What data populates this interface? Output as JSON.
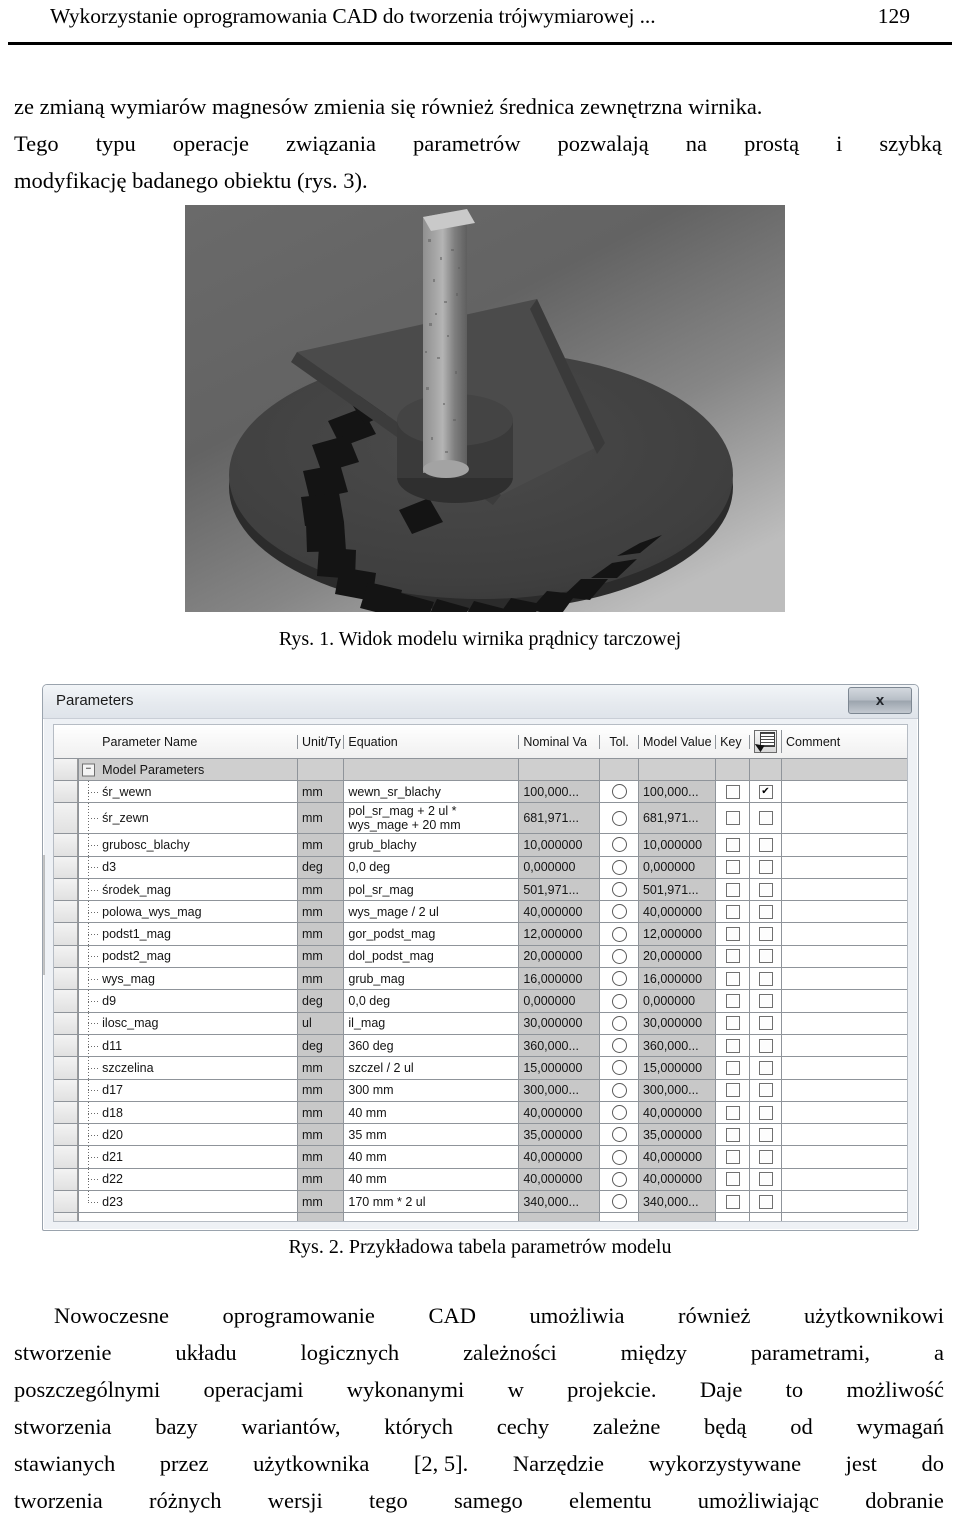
{
  "header": {
    "running_title": "Wykorzystanie oprogramowania CAD do tworzenia trójwymiarowej ...",
    "page_number": "129"
  },
  "paragraph_top": {
    "line1": "ze zmianą wymiarów magnesów zmienia się również średnica zewnętrzna wirnika.",
    "line2_a": "Tego",
    "line2_b": "typu",
    "line2_c": "operacje",
    "line2_d": "związania",
    "line2_e": "parametrów",
    "line2_f": "pozwalają",
    "line2_g": "na",
    "line2_h": "prostą",
    "line2_i": "i",
    "line2_j": "szybką",
    "line3": "modyfikację badanego obiektu (rys. 3)."
  },
  "figure1": {
    "caption": "Rys. 1. Widok modelu wirnika prądnicy tarczowej",
    "alt": "Widok modelu wirnika prądnicy tarczowej — render 3D tarczy z magnesami i wałem"
  },
  "figure2": {
    "caption": "Rys. 2. Przykładowa tabela parametrów modelu"
  },
  "parameters_window": {
    "title": "Parameters",
    "close_label": "x",
    "columns": [
      "Parameter Name",
      "Unit/Ty",
      "Equation",
      "Nominal Va",
      "Tol.",
      "Model Value",
      "Key",
      "",
      "Comment"
    ],
    "group_label": "Model Parameters",
    "export_icon": "export-table-icon",
    "rows": [
      {
        "name": "śr_wewn",
        "unit": "mm",
        "equation": "wewn_sr_blachy",
        "nominal": "100,000...",
        "tol": "tolerance-circle",
        "model_value": "100,000...",
        "key": false,
        "exported": true,
        "comment": ""
      },
      {
        "name": "śr_zewn",
        "unit": "mm",
        "equation": "pol_sr_mag + 2 ul * wys_mage + 20 mm",
        "nominal": "681,971...",
        "tol": "tolerance-circle",
        "model_value": "681,971...",
        "key": false,
        "exported": false,
        "comment": ""
      },
      {
        "name": "grubosc_blachy",
        "unit": "mm",
        "equation": "grub_blachy",
        "nominal": "10,000000",
        "tol": "tolerance-circle",
        "model_value": "10,000000",
        "key": false,
        "exported": false,
        "comment": ""
      },
      {
        "name": "d3",
        "unit": "deg",
        "equation": "0,0 deg",
        "nominal": "0,000000",
        "tol": "tolerance-circle",
        "model_value": "0,000000",
        "key": false,
        "exported": false,
        "comment": ""
      },
      {
        "name": "środek_mag",
        "unit": "mm",
        "equation": "pol_sr_mag",
        "nominal": "501,971...",
        "tol": "tolerance-circle",
        "model_value": "501,971...",
        "key": false,
        "exported": false,
        "comment": ""
      },
      {
        "name": "polowa_wys_mag",
        "unit": "mm",
        "equation": "wys_mage / 2 ul",
        "nominal": "40,000000",
        "tol": "tolerance-circle",
        "model_value": "40,000000",
        "key": false,
        "exported": false,
        "comment": ""
      },
      {
        "name": "podst1_mag",
        "unit": "mm",
        "equation": "gor_podst_mag",
        "nominal": "12,000000",
        "tol": "tolerance-circle",
        "model_value": "12,000000",
        "key": false,
        "exported": false,
        "comment": ""
      },
      {
        "name": "podst2_mag",
        "unit": "mm",
        "equation": "dol_podst_mag",
        "nominal": "20,000000",
        "tol": "tolerance-circle",
        "model_value": "20,000000",
        "key": false,
        "exported": false,
        "comment": ""
      },
      {
        "name": "wys_mag",
        "unit": "mm",
        "equation": "grub_mag",
        "nominal": "16,000000",
        "tol": "tolerance-circle",
        "model_value": "16,000000",
        "key": false,
        "exported": false,
        "comment": ""
      },
      {
        "name": "d9",
        "unit": "deg",
        "equation": "0,0 deg",
        "nominal": "0,000000",
        "tol": "tolerance-circle",
        "model_value": "0,000000",
        "key": false,
        "exported": false,
        "comment": ""
      },
      {
        "name": "ilosc_mag",
        "unit": "ul",
        "equation": "il_mag",
        "nominal": "30,000000",
        "tol": "tolerance-circle",
        "model_value": "30,000000",
        "key": false,
        "exported": false,
        "comment": ""
      },
      {
        "name": "d11",
        "unit": "deg",
        "equation": "360 deg",
        "nominal": "360,000...",
        "tol": "tolerance-circle",
        "model_value": "360,000...",
        "key": false,
        "exported": false,
        "comment": ""
      },
      {
        "name": "szczelina",
        "unit": "mm",
        "equation": "szczel / 2 ul",
        "nominal": "15,000000",
        "tol": "tolerance-circle",
        "model_value": "15,000000",
        "key": false,
        "exported": false,
        "comment": ""
      },
      {
        "name": "d17",
        "unit": "mm",
        "equation": "300 mm",
        "nominal": "300,000...",
        "tol": "tolerance-circle",
        "model_value": "300,000...",
        "key": false,
        "exported": false,
        "comment": ""
      },
      {
        "name": "d18",
        "unit": "mm",
        "equation": "40 mm",
        "nominal": "40,000000",
        "tol": "tolerance-circle",
        "model_value": "40,000000",
        "key": false,
        "exported": false,
        "comment": ""
      },
      {
        "name": "d20",
        "unit": "mm",
        "equation": "35 mm",
        "nominal": "35,000000",
        "tol": "tolerance-circle",
        "model_value": "35,000000",
        "key": false,
        "exported": false,
        "comment": ""
      },
      {
        "name": "d21",
        "unit": "mm",
        "equation": "40 mm",
        "nominal": "40,000000",
        "tol": "tolerance-circle",
        "model_value": "40,000000",
        "key": false,
        "exported": false,
        "comment": ""
      },
      {
        "name": "d22",
        "unit": "mm",
        "equation": "40 mm",
        "nominal": "40,000000",
        "tol": "tolerance-circle",
        "model_value": "40,000000",
        "key": false,
        "exported": false,
        "comment": ""
      },
      {
        "name": "d23",
        "unit": "mm",
        "equation": "170 mm * 2 ul",
        "nominal": "340,000...",
        "tol": "tolerance-circle",
        "model_value": "340,000...",
        "key": false,
        "exported": false,
        "comment": ""
      }
    ]
  },
  "paragraph_bottom": {
    "l1_a": "Nowoczesne",
    "l1_b": "oprogramowanie",
    "l1_c": "CAD",
    "l1_d": "umożliwia",
    "l1_e": "również",
    "l1_f": "użytkownikowi",
    "l2_a": "stworzenie",
    "l2_b": "układu",
    "l2_c": "logicznych",
    "l2_d": "zależności",
    "l2_e": "między",
    "l2_f": "parametrami,",
    "l2_g": "a",
    "l3_a": "poszczególnymi",
    "l3_b": "operacjami",
    "l3_c": "wykonanymi",
    "l3_d": "w",
    "l3_e": "projekcie.",
    "l3_f": "Daje",
    "l3_g": "to",
    "l3_h": "możliwość",
    "l4_a": "stworzenia",
    "l4_b": "bazy",
    "l4_c": "wariantów,",
    "l4_d": "których",
    "l4_e": "cechy",
    "l4_f": "zależne",
    "l4_g": "będą",
    "l4_h": "od",
    "l4_i": "wymagań",
    "l5_a": "stawianych",
    "l5_b": "przez",
    "l5_c": "użytkownika",
    "l5_d": "[2, 5].",
    "l5_e": "Narzędzie",
    "l5_f": "wykorzystywane",
    "l5_g": "jest",
    "l5_h": "do",
    "l6_a": "tworzenia",
    "l6_b": "różnych",
    "l6_c": "wersji",
    "l6_d": "tego",
    "l6_e": "samego",
    "l6_f": "elementu",
    "l6_g": "umożliwiając",
    "l6_h": "dobranie"
  }
}
